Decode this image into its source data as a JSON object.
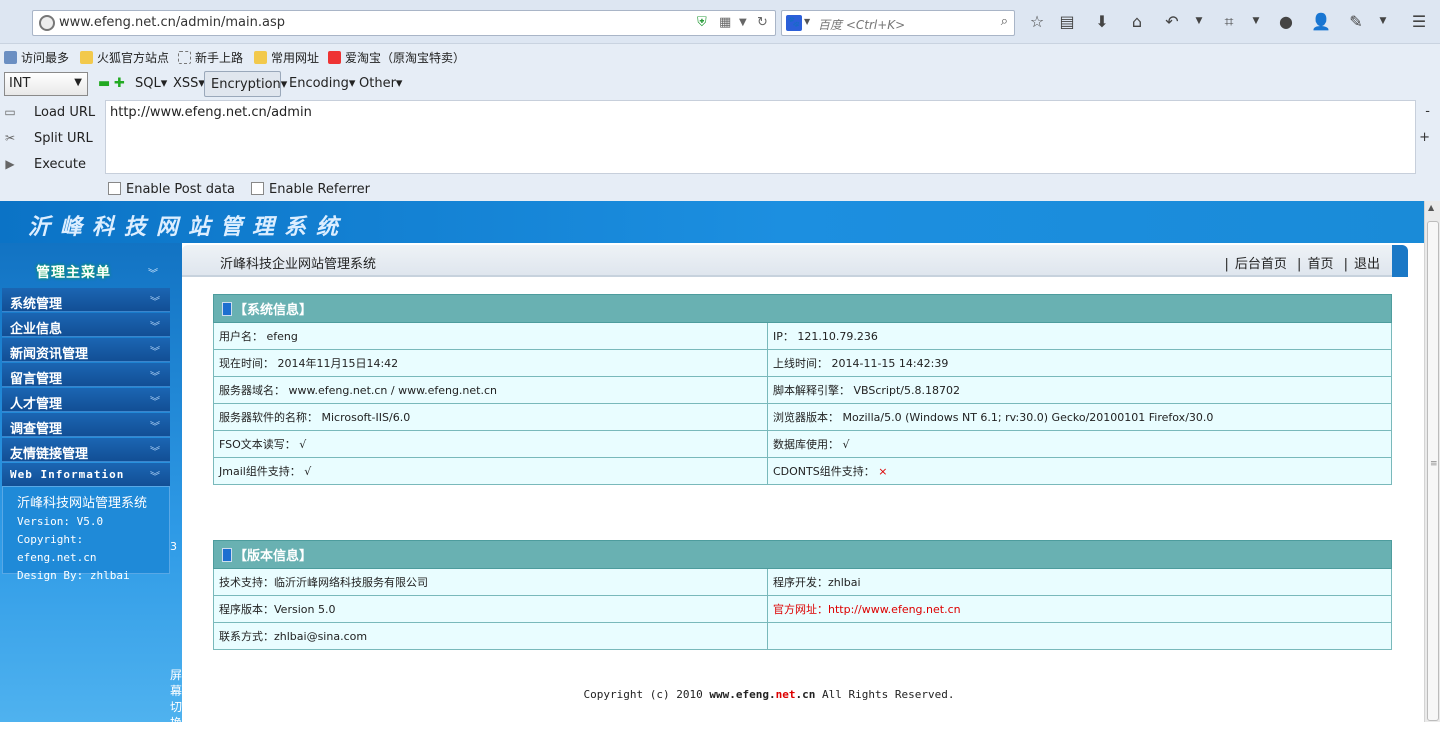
{
  "browser": {
    "url": "www.efeng.net.cn/admin/main.asp",
    "search_placeholder": "百度 <Ctrl+K>",
    "bookmarks": [
      "访问最多",
      "火狐官方站点",
      "新手上路",
      "常用网址",
      "爱淘宝（原淘宝特卖）"
    ]
  },
  "hackbar": {
    "select_value": "INT",
    "menus": [
      "SQL",
      "XSS",
      "Encryption",
      "Encoding",
      "Other"
    ],
    "buttons": [
      "Load URL",
      "Split URL",
      "Execute"
    ],
    "url_value": "http://www.efeng.net.cn/admin",
    "enable_post": "Enable Post data",
    "enable_referrer": "Enable Referrer",
    "minus": "-",
    "plus": "+"
  },
  "admin": {
    "banner_title": "沂峰科技网站管理系统",
    "menu_head": "管理主菜单",
    "menu_items": [
      "系统管理",
      "企业信息",
      "新闻资讯管理",
      "留言管理",
      "人才管理",
      "调查管理",
      "友情链接管理",
      "Web Information"
    ],
    "webinfo": [
      "沂峰科技网站管理系统",
      "Version: V5.0",
      "Copyright: efeng.net.cn",
      "Design By: zhlbai"
    ],
    "side_number": "3",
    "side_vertical": "屏幕切换",
    "page_title": "沂峰科技企业网站管理系统",
    "top_links": [
      "后台首页",
      "首页",
      "退出"
    ],
    "sysinfo_title": "【系统信息】",
    "sysinfo": [
      [
        "用户名： efeng",
        "IP： 121.10.79.236"
      ],
      [
        "现在时间： 2014年11月15日14:42",
        "上线时间： 2014-11-15 14:42:39"
      ],
      [
        "服务器域名： www.efeng.net.cn / www.efeng.net.cn",
        "脚本解释引擎： VBScript/5.8.18702"
      ],
      [
        "服务器软件的名称： Microsoft-IIS/6.0",
        "浏览器版本： Mozilla/5.0 (Windows NT 6.1; rv:30.0) Gecko/20100101 Firefox/30.0"
      ],
      [
        "FSO文本读写： √",
        "数据库使用： √"
      ],
      [
        "Jmail组件支持： √",
        "CDONTS组件支持： ×"
      ]
    ],
    "version_title": "【版本信息】",
    "version": [
      [
        "技术支持：临沂沂峰网络科技服务有限公司",
        "程序开发：zhlbai"
      ],
      [
        "程序版本：Version 5.0",
        "官方网址：http://www.efeng.net.cn"
      ],
      [
        "联系方式：zhlbai@sina.com",
        ""
      ]
    ],
    "footer_pre": "Copyright (c) 2010 ",
    "footer_site_a": "www.efeng.",
    "footer_site_b": "net",
    "footer_site_c": ".cn",
    "footer_post": " All Rights Reserved."
  }
}
